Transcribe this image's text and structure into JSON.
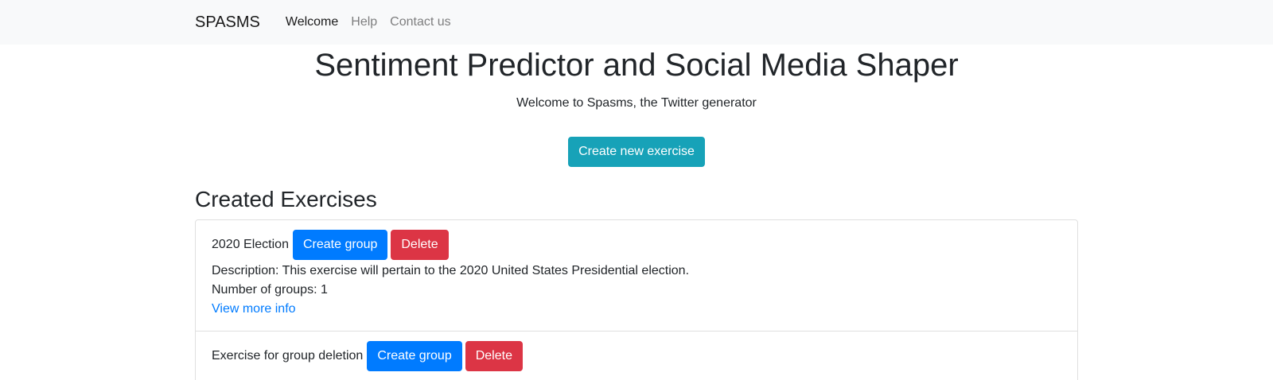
{
  "navbar": {
    "brand": "SPASMS",
    "links": [
      {
        "label": "Welcome",
        "active": true
      },
      {
        "label": "Help",
        "active": false
      },
      {
        "label": "Contact us",
        "active": false
      }
    ]
  },
  "header": {
    "title": "Sentiment Predictor and Social Media Shaper",
    "subtitle": "Welcome to Spasms, the Twitter generator"
  },
  "actions": {
    "create_exercise_label": "Create new exercise"
  },
  "exercises": {
    "section_title": "Created Exercises",
    "items": [
      {
        "name": "2020 Election",
        "create_group_label": "Create group",
        "delete_label": "Delete",
        "description": "Description: This exercise will pertain to the 2020 United States Presidential election.",
        "groups": "Number of groups: 1",
        "more_info_label": "View more info"
      },
      {
        "name": "Exercise for group deletion",
        "create_group_label": "Create group",
        "delete_label": "Delete"
      }
    ]
  },
  "colors": {
    "navbar_bg": "#f8f9fa",
    "info": "#17a2b8",
    "primary": "#007bff",
    "danger": "#dc3545",
    "link": "#007bff"
  }
}
